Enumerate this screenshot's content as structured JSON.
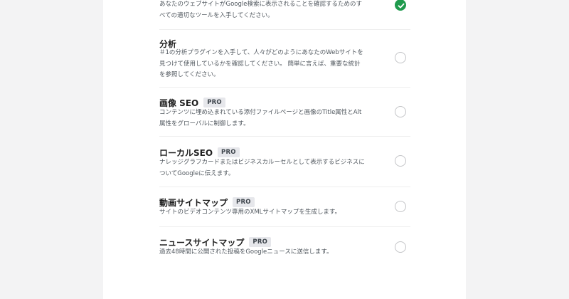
{
  "features": [
    {
      "title": "",
      "pro": false,
      "desc": "あなたのウェブサイトがGoogle検索に表示されることを確認するためのすべての適切なツールを入手してください。",
      "enabled": true
    },
    {
      "title": "分析",
      "pro": false,
      "desc": "＃1の分析プラグインを入手して、人々がどのようにあなたのWebサイトを見つけて使用しているかを確認してください。 簡単に言えば、重要な統計を参照してください。",
      "enabled": false
    },
    {
      "title": "画像 SEO",
      "pro": true,
      "desc": "コンテンツに埋め込まれている添付ファイルページと画像のTitle属性とAlt属性をグローバルに制御します。",
      "enabled": false
    },
    {
      "title": "ローカルSEO",
      "pro": true,
      "desc": "ナレッジグラフカードまたはビジネスカルーセルとして表示するビジネスについてGoogleに伝えます。",
      "enabled": false
    },
    {
      "title": "動画サイトマップ",
      "pro": true,
      "desc": "サイトのビデオコンテンツ専用のXMLサイトマップを生成します。",
      "enabled": false
    },
    {
      "title": "ニュースサイトマップ",
      "pro": true,
      "desc": "過去48時間に公開された投稿をGoogleニュースに送信します。",
      "enabled": false
    }
  ],
  "badge_label": "PRO",
  "colors": {
    "checked": "#1f9a4d",
    "unchecked_border": "#c3c4c7"
  }
}
